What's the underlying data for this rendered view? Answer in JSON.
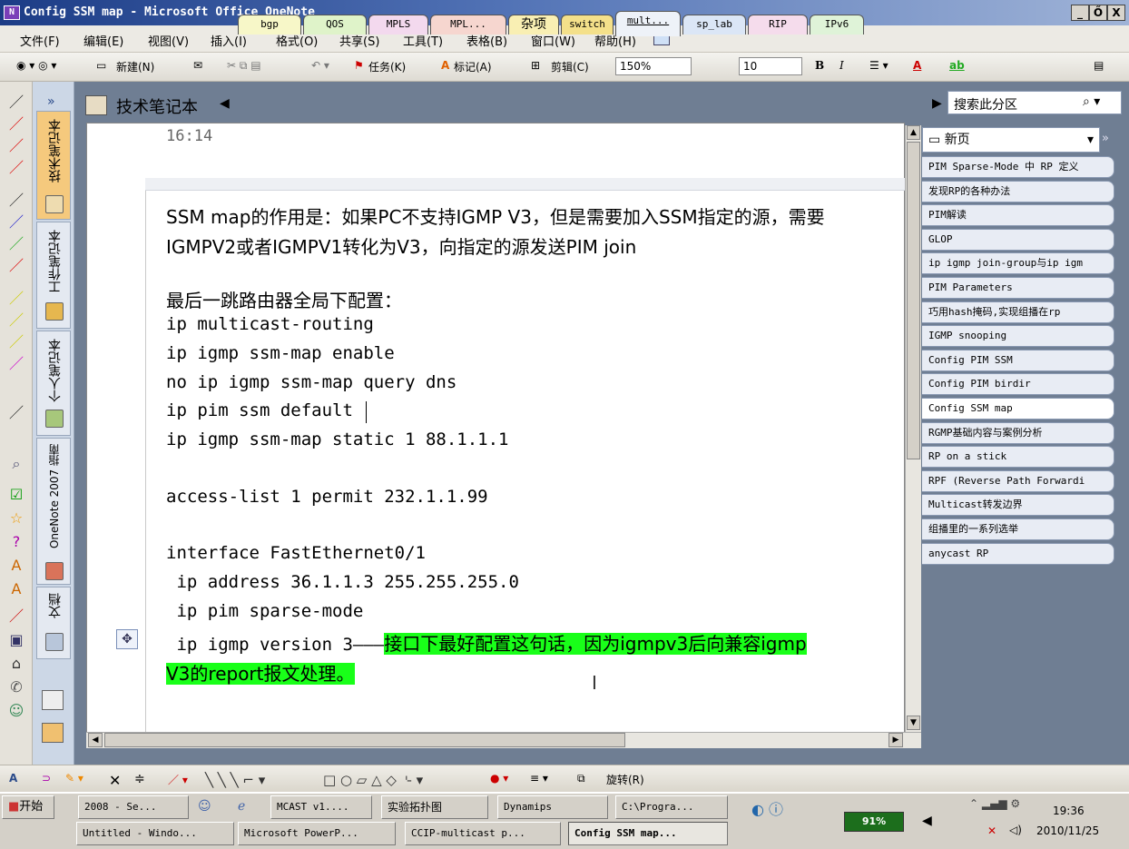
{
  "window": {
    "title": "Config SSM map - Microsoft Office OneNote",
    "minimize": "_",
    "restore": "Ő",
    "close": "X"
  },
  "menu": [
    "文件(F)",
    "编辑(E)",
    "视图(V)",
    "插入(I)",
    "格式(O)",
    "共享(S)",
    "工具(T)",
    "表格(B)",
    "窗口(W)",
    "帮助(H)"
  ],
  "toolbar": {
    "new_label": "新建(N)",
    "task_label": "任务(K)",
    "tag_label": "标记(A)",
    "clip_label": "剪辑(C)",
    "zoom": "150%",
    "font_size": "10",
    "bold": "B",
    "italic": "I",
    "font_color_letter": "A",
    "highlight_letter": "ab"
  },
  "notebooks": [
    {
      "label": "技术笔记本",
      "selected": true
    },
    {
      "label": "工作笔记本",
      "selected": false
    },
    {
      "label": "个人笔记本",
      "selected": false
    },
    {
      "label": "OneNote 2007 指南",
      "selected": false
    },
    {
      "label": "文档",
      "selected": false
    }
  ],
  "notebook_header": "技术笔记本",
  "sections": [
    {
      "label": "bgp",
      "color": "#f7f7c8"
    },
    {
      "label": "QOS",
      "color": "#dff3c9"
    },
    {
      "label": "MPLS",
      "color": "#f3d9ee"
    },
    {
      "label": "MPL...",
      "color": "#f6d6cf"
    },
    {
      "label": "杂项",
      "color": "#f9efb3"
    },
    {
      "label": "switch",
      "color": "#f4e08a"
    },
    {
      "label": "mult...",
      "color": "#eef2f8",
      "selected": true
    },
    {
      "label": "sp_lab",
      "color": "#dbe6f6"
    },
    {
      "label": "RIP",
      "color": "#f5dcec"
    },
    {
      "label": "IPv6",
      "color": "#dff3d8"
    }
  ],
  "search": {
    "placeholder": "搜索此分区"
  },
  "page": {
    "time": "16:14",
    "intro1": "SSM map的作用是：如果PC不支持IGMP V3，但是需要加入SSM指定的源，需要",
    "intro2": "IGMPV2或者IGMPV1转化为V3，向指定的源发送PIM join",
    "heading": "最后一跳路由器全局下配置：",
    "config": [
      "ip multicast-routing",
      "ip igmp ssm-map enable",
      "no ip igmp ssm-map query dns",
      "ip pim ssm default",
      "ip igmp ssm-map static 1 88.1.1.1",
      "",
      "access-list 1 permit 232.1.1.99",
      "",
      "interface FastEthernet0/1",
      " ip address 36.1.1.3 255.255.255.0",
      " ip pim sparse-mode"
    ],
    "last_line_code": " ip igmp version 3———",
    "last_line_note": "接口下最好配置这句话，因为igmpv3后向兼容igmp",
    "last_line_wrap": "V3的report报文处理。"
  },
  "pages_panel": {
    "new_page": "新页",
    "pages": [
      "PIM Sparse-Mode 中 RP 定义",
      "发现RP的各种办法",
      "PIM解读",
      "GLOP",
      "ip igmp join-group与ip igm",
      "PIM Parameters",
      "巧用hash掩码,实现组播在rp",
      "IGMP snooping",
      "Config PIM SSM",
      "Config PIM birdir",
      "Config SSM map",
      "RGMP基础内容与案例分析",
      "RP on a stick",
      "RPF (Reverse Path Forwardi",
      "Multicast转发边界",
      "组播里的一系列选举",
      "anycast RP"
    ],
    "selected_index": 10
  },
  "drawbar": {
    "rotate_label": "旋转(R)"
  },
  "taskbar": {
    "start": "开始",
    "row1": [
      "2008 - Se...",
      "MCAST v1....",
      "实验拓扑图",
      "Dynamips",
      "C:\\Progra..."
    ],
    "row2": [
      "Untitled - Windo...",
      "Microsoft PowerP...",
      "CCIP-multicast p...",
      "Config SSM map..."
    ],
    "battery": "91%",
    "time": "19:36",
    "date": "2010/11/25"
  },
  "colors": {
    "highlight": "#19ff19",
    "title_start": "#1c3c86",
    "selected_notebook": "#f5c97d"
  }
}
